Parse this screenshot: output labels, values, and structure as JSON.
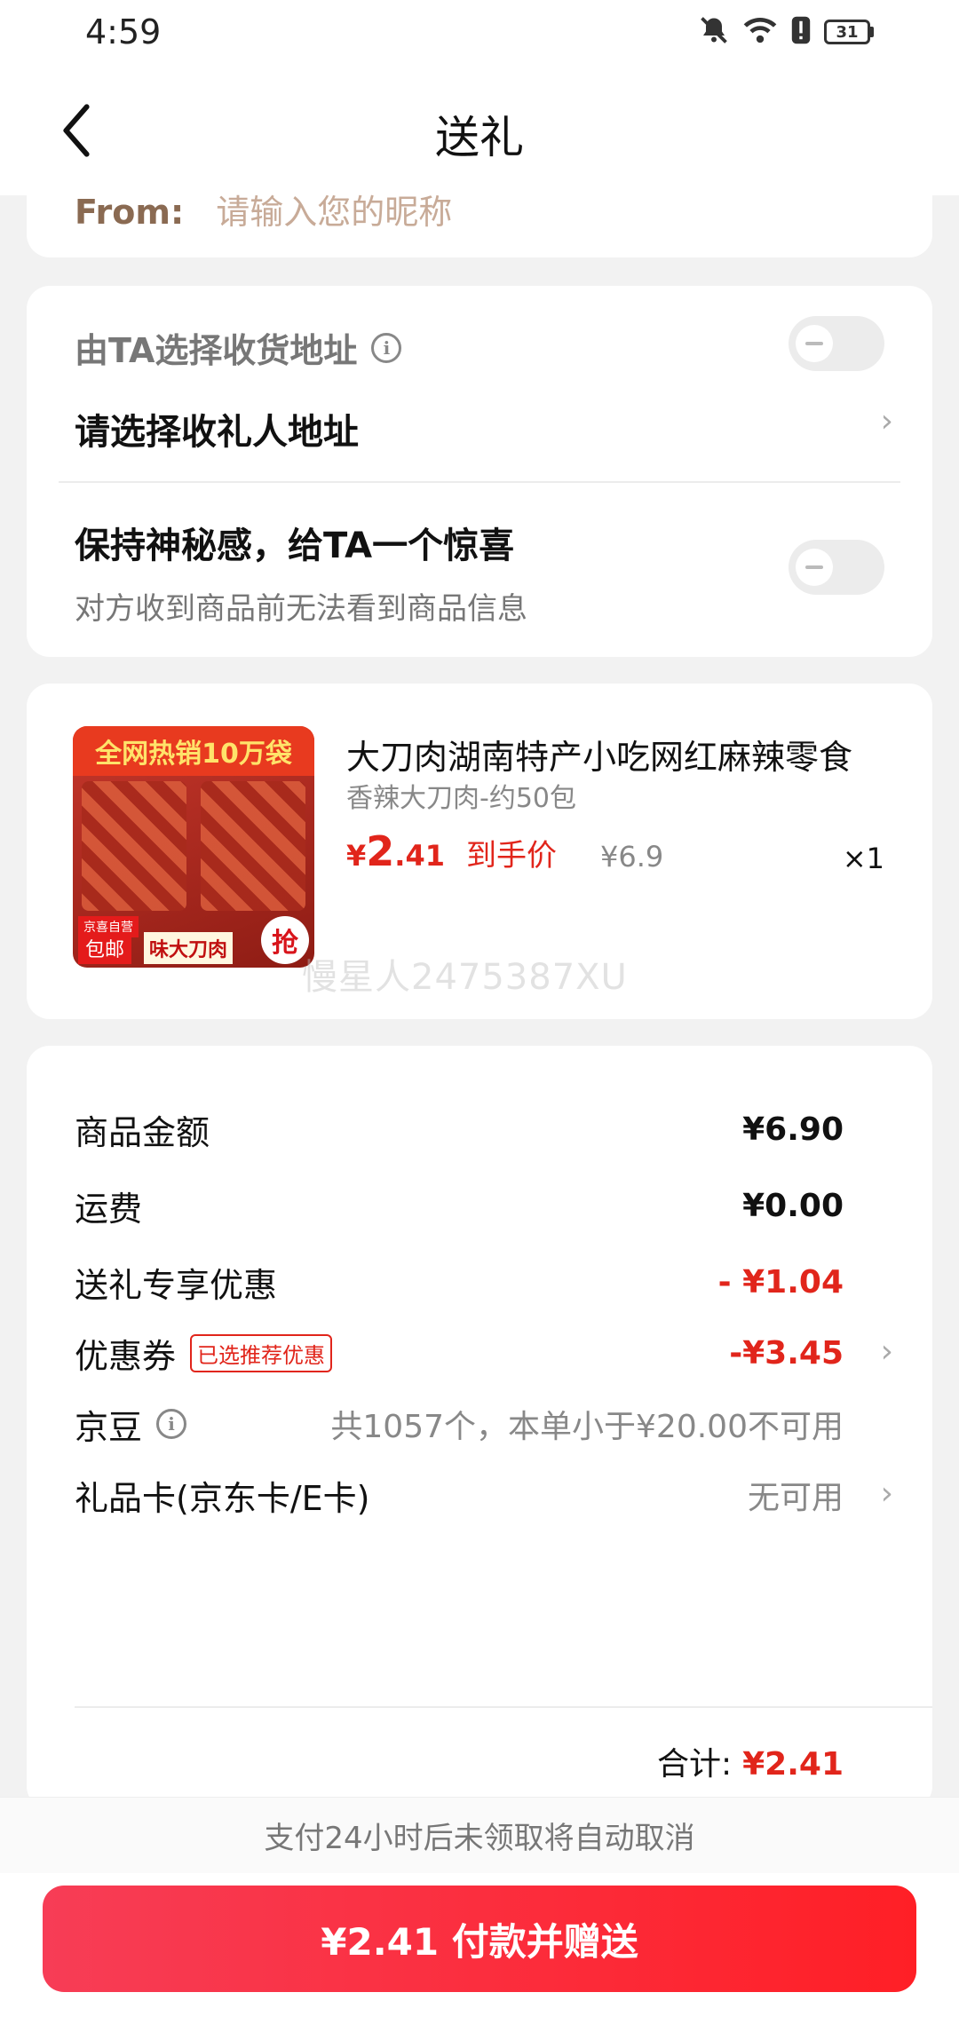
{
  "status_bar": {
    "time": "4:59",
    "battery": "31",
    "icons": [
      "bell-muted-icon",
      "wifi-icon",
      "alert-icon",
      "battery-icon"
    ]
  },
  "nav": {
    "title": "送礼",
    "back_icon": "chevron-left-icon"
  },
  "sender": {
    "label": "From:",
    "placeholder": "请输入您的昵称"
  },
  "address": {
    "ta_choose_label": "由TA选择收货地址",
    "ta_choose_enabled": false,
    "select_label": "请选择收礼人地址",
    "mystery_title": "保持神秘感，给TA一个惊喜",
    "mystery_subtitle": "对方收到商品前无法看到商品信息",
    "mystery_enabled": false
  },
  "product": {
    "image_banner": "全网热销10万袋",
    "image_tag_self": "京喜自营",
    "image_tag_ship": "包邮",
    "image_tag_name": "味大刀肉",
    "image_tag_grab": "抢",
    "title": "大刀肉湖南特产小吃网红麻辣零食",
    "spec": "香辣大刀肉-约50包",
    "price_currency": "¥",
    "price_int": "2",
    "price_dec": ".41",
    "price_label": "到手价",
    "original_price": "¥6.9",
    "quantity": "×1",
    "watermark": "慢星人2475387XU"
  },
  "summary": {
    "rows": [
      {
        "label": "商品金额",
        "value": "¥6.90"
      },
      {
        "label": "运费",
        "value": "¥0.00"
      },
      {
        "label": "送礼专享优惠",
        "value": "- ¥1.04"
      },
      {
        "label": "优惠券",
        "badge": "已选推荐优惠",
        "value": "-¥3.45"
      },
      {
        "label": "京豆",
        "value": "共1057个，本单小于¥20.00不可用"
      },
      {
        "label": "礼品卡(京东卡/E卡)",
        "value": "无可用"
      }
    ],
    "total_label": "合计:",
    "total_value": "¥2.41"
  },
  "footer": {
    "notice": "支付24小时后未领取将自动取消",
    "pay_button": "¥2.41 付款并赠送"
  },
  "colors": {
    "accent": "#e1251b",
    "button_start": "#f73d56",
    "button_end": "#ff1f26",
    "background": "#f2f2f2"
  }
}
